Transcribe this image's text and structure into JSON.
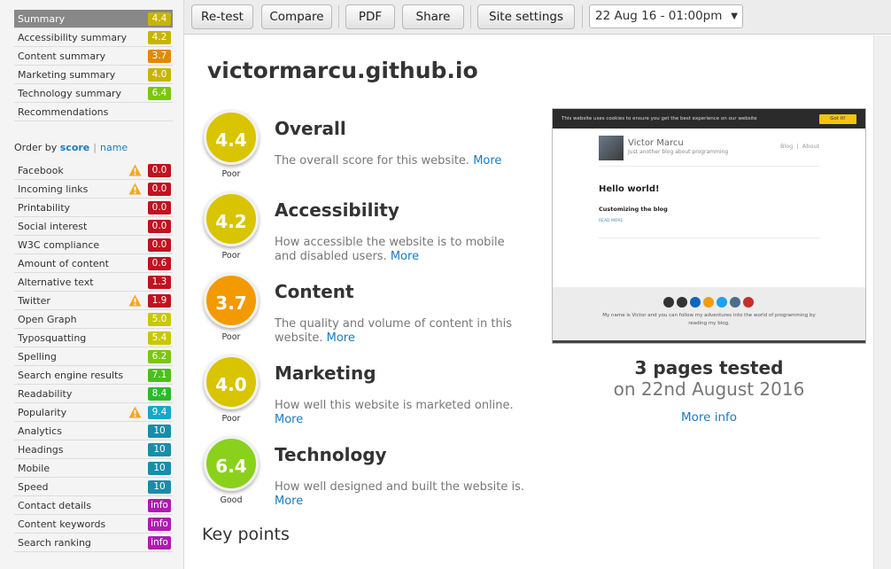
{
  "sidebar": {
    "nav": [
      {
        "label": "Summary",
        "score": "4.4",
        "color": "#c8b400",
        "active": true
      },
      {
        "label": "Accessibility summary",
        "score": "4.2",
        "color": "#c8b400",
        "active": false
      },
      {
        "label": "Content summary",
        "score": "3.7",
        "color": "#e08a00",
        "active": false
      },
      {
        "label": "Marketing summary",
        "score": "4.0",
        "color": "#c8b400",
        "active": false
      },
      {
        "label": "Technology summary",
        "score": "6.4",
        "color": "#7ac70c",
        "active": false
      },
      {
        "label": "Recommendations",
        "score": null,
        "color": null,
        "active": false
      }
    ],
    "order": {
      "prefix": "Order by",
      "score_link": "score",
      "separator": "|",
      "name_link": "name"
    },
    "metrics": [
      {
        "label": "Facebook",
        "value": "0.0",
        "color": "#c0121f",
        "warning": true
      },
      {
        "label": "Incoming links",
        "value": "0.0",
        "color": "#c0121f",
        "warning": true
      },
      {
        "label": "Printability",
        "value": "0.0",
        "color": "#c0121f",
        "warning": false
      },
      {
        "label": "Social interest",
        "value": "0.0",
        "color": "#c0121f",
        "warning": false
      },
      {
        "label": "W3C compliance",
        "value": "0.0",
        "color": "#c0121f",
        "warning": false
      },
      {
        "label": "Amount of content",
        "value": "0.6",
        "color": "#c0121f",
        "warning": false
      },
      {
        "label": "Alternative text",
        "value": "1.3",
        "color": "#c0121f",
        "warning": false
      },
      {
        "label": "Twitter",
        "value": "1.9",
        "color": "#c0121f",
        "warning": true
      },
      {
        "label": "Open Graph",
        "value": "5.0",
        "color": "#c8c800",
        "warning": false
      },
      {
        "label": "Typosquatting",
        "value": "5.4",
        "color": "#c8c800",
        "warning": false
      },
      {
        "label": "Spelling",
        "value": "6.2",
        "color": "#7ac70c",
        "warning": false
      },
      {
        "label": "Search engine results",
        "value": "7.1",
        "color": "#4cbf1a",
        "warning": false
      },
      {
        "label": "Readability",
        "value": "8.4",
        "color": "#2eb82e",
        "warning": false
      },
      {
        "label": "Popularity",
        "value": "9.4",
        "color": "#13a9c6",
        "warning": true
      },
      {
        "label": "Analytics",
        "value": "10",
        "color": "#1a8caa",
        "warning": false
      },
      {
        "label": "Headings",
        "value": "10",
        "color": "#1a8caa",
        "warning": false
      },
      {
        "label": "Mobile",
        "value": "10",
        "color": "#1a8caa",
        "warning": false
      },
      {
        "label": "Speed",
        "value": "10",
        "color": "#1a8caa",
        "warning": false
      },
      {
        "label": "Contact details",
        "value": "info",
        "color": "#b01ab0",
        "warning": false
      },
      {
        "label": "Content keywords",
        "value": "info",
        "color": "#b01ab0",
        "warning": false
      },
      {
        "label": "Search ranking",
        "value": "info",
        "color": "#b01ab0",
        "warning": false
      }
    ]
  },
  "toolbar": {
    "retest": "Re-test",
    "compare": "Compare",
    "pdf": "PDF",
    "share": "Share",
    "site_settings": "Site settings",
    "date": "22 Aug 16 - 01:00pm",
    "date_arrow": "▼"
  },
  "main": {
    "site_title": "victormarcu.github.io",
    "sections": [
      {
        "score": "4.4",
        "grade": "Poor",
        "title": "Overall",
        "desc": "The overall score for this website.",
        "more": "More",
        "color": "#d9c400"
      },
      {
        "score": "4.2",
        "grade": "Poor",
        "title": "Accessibility",
        "desc": "How accessible the website is to mobile and disabled users.",
        "more": "More",
        "color": "#d9c400"
      },
      {
        "score": "3.7",
        "grade": "Poor",
        "title": "Content",
        "desc": "The quality and volume of content in this website.",
        "more": "More",
        "color": "#f29a00"
      },
      {
        "score": "4.0",
        "grade": "Poor",
        "title": "Marketing",
        "desc": "How well this website is marketed online.",
        "more": "More",
        "color": "#d9c400"
      },
      {
        "score": "6.4",
        "grade": "Good",
        "title": "Technology",
        "desc": "How well designed and built the website is.",
        "more": "More",
        "color": "#8ad11c"
      }
    ],
    "key_points": "Key points"
  },
  "preview": {
    "cookie_text": "This website uses cookies to ensure you get the best experience on our website",
    "cookie_button": "Got it!",
    "site_name": "Victor Marcu",
    "tagline": "Just another blog about programming",
    "nav_blog": "Blog",
    "nav_about": "About",
    "post_title": "Hello world!",
    "post_subtitle": "Customizing the blog",
    "read_more": "READ MORE",
    "footer_text": "My name is Victor and you can follow my adventures into the world of programming by reading my blog.",
    "icons": [
      "mail-icon",
      "github-icon",
      "linkedin-icon",
      "rss-icon",
      "twitter-icon",
      "instagram-icon",
      "youtube-icon"
    ],
    "icon_colors": [
      "#333333",
      "#333333",
      "#0a66c2",
      "#f39c12",
      "#1da1f2",
      "#4a6d8c",
      "#c4302b"
    ]
  },
  "summary": {
    "pages_tested": "3 pages tested",
    "tested_on": "on 22nd August 2016",
    "more_info": "More info"
  }
}
